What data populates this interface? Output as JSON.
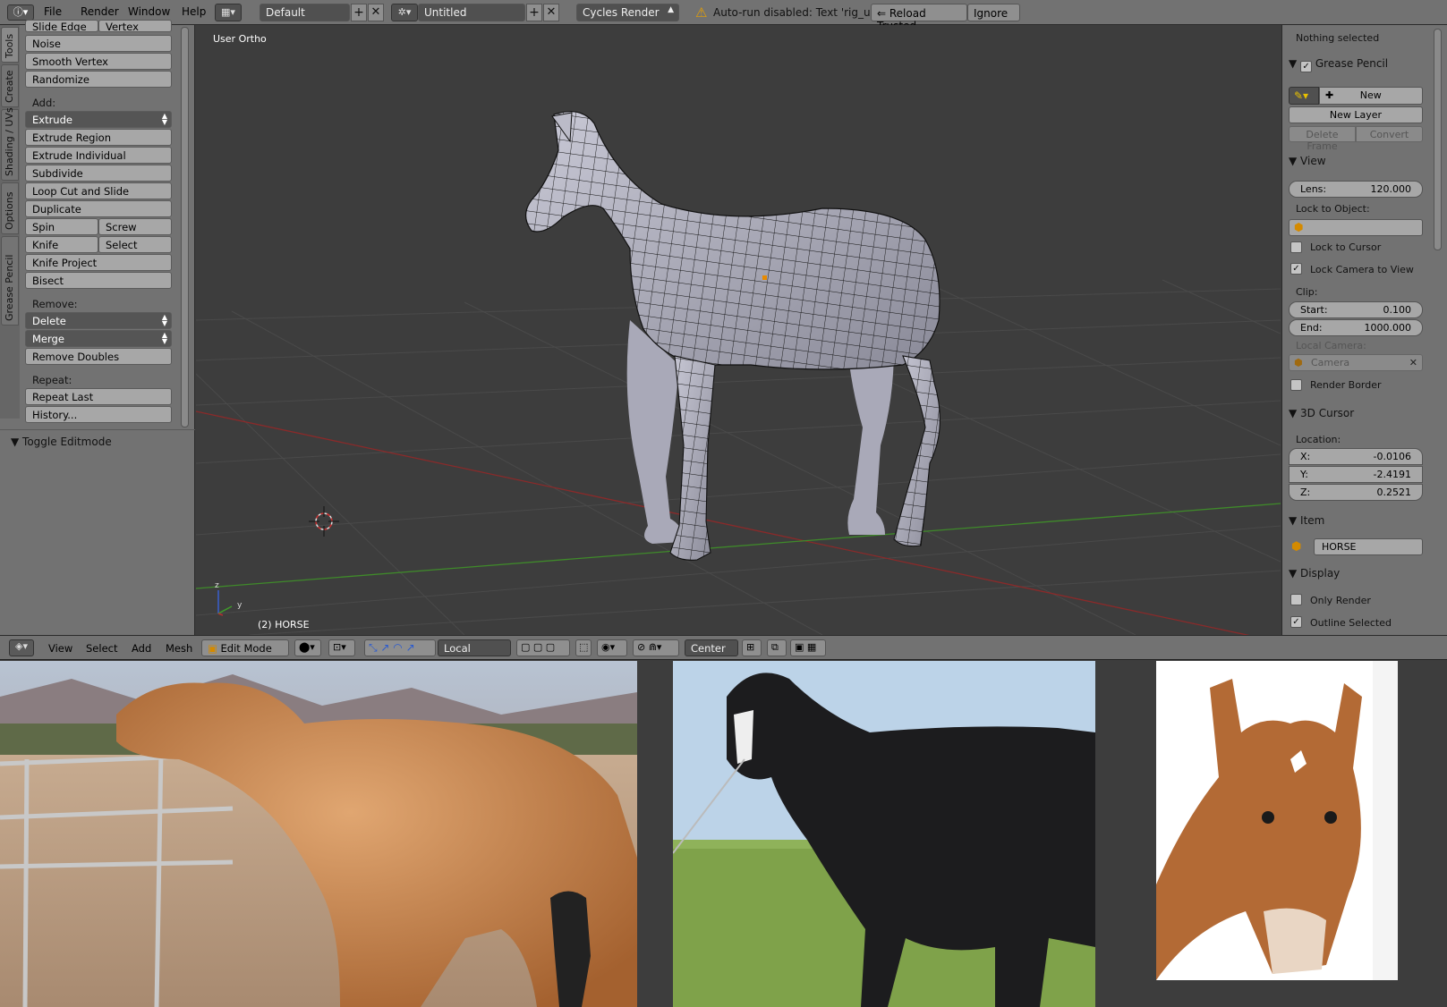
{
  "topbar": {
    "menus": [
      "File",
      "Render",
      "Window",
      "Help"
    ],
    "screen_layout": "Default",
    "scene": "Untitled",
    "render_engine": "Cycles Render",
    "warning": "Auto-run disabled: Text 'rig_ui.py'",
    "reload_trusted": "Reload Trusted",
    "ignore": "Ignore"
  },
  "toolshelf": {
    "tabs": [
      "Tools",
      "Create",
      "Shading / UVs",
      "Options",
      "Grease Pencil"
    ],
    "partial_top": [
      "Slide Edge",
      "Vertex"
    ],
    "top_buttons": [
      "Noise",
      "Smooth Vertex",
      "Randomize"
    ],
    "add_label": "Add:",
    "extrude": "Extrude",
    "add_buttons": [
      "Extrude Region",
      "Extrude Individual",
      "Subdivide",
      "Loop Cut and Slide",
      "Duplicate"
    ],
    "spin": "Spin",
    "screw": "Screw",
    "knife": "Knife",
    "select": "Select",
    "add_buttons2": [
      "Knife Project",
      "Bisect"
    ],
    "remove_label": "Remove:",
    "delete": "Delete",
    "merge": "Merge",
    "remove_doubles": "Remove Doubles",
    "repeat_label": "Repeat:",
    "repeat_last": "Repeat Last",
    "history": "History...",
    "toggle_editmode": "Toggle Editmode"
  },
  "viewport": {
    "view_label": "User Ortho",
    "object_label": "(2) HORSE",
    "axis_z": "z",
    "axis_y": "y"
  },
  "npanel": {
    "nothing_selected": "Nothing selected",
    "grease_pencil": "Grease Pencil",
    "new": "New",
    "new_layer": "New Layer",
    "delete_frame": "Delete Frame",
    "convert": "Convert",
    "view": "View",
    "lens_label": "Lens:",
    "lens_value": "120.000",
    "lock_to_object": "Lock to Object:",
    "lock_to_cursor": "Lock to Cursor",
    "lock_camera_to_view": "Lock Camera to View",
    "clip": "Clip:",
    "start_label": "Start:",
    "start_value": "0.100",
    "end_label": "End:",
    "end_value": "1000.000",
    "local_camera": "Local Camera:",
    "camera": "Camera",
    "render_border": "Render Border",
    "cursor_3d": "3D Cursor",
    "location": "Location:",
    "x_label": "X:",
    "x_value": "-0.0106",
    "y_label": "Y:",
    "y_value": "-2.4191",
    "z_label": "Z:",
    "z_value": "0.2521",
    "item": "Item",
    "item_name": "HORSE",
    "display": "Display",
    "only_render": "Only Render",
    "outline_selected": "Outline Selected"
  },
  "viewheader": {
    "menus": [
      "View",
      "Select",
      "Add",
      "Mesh"
    ],
    "mode": "Edit Mode",
    "orientation": "Local",
    "pivot": "Center"
  },
  "colors": {
    "panel": "#727272",
    "viewport": "#3d3d3d",
    "button": "#a7a7a7",
    "button_dark": "#555555",
    "x_axis": "#8a2a2a",
    "y_axis": "#3f8a2a",
    "warning": "#e8a000"
  }
}
